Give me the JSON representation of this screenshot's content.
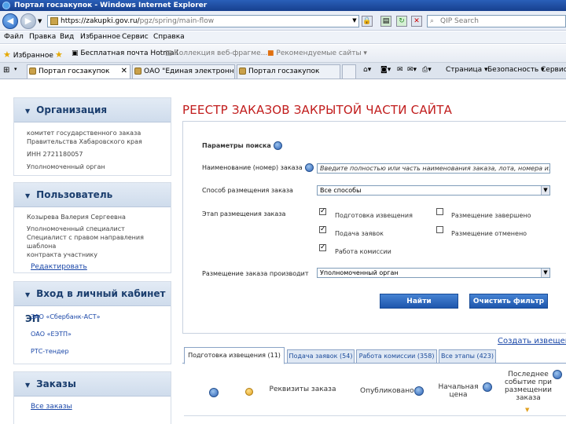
{
  "browser": {
    "title": "Портал госзакупок - Windows Internet Explorer",
    "url_main": "https://zakupki.gov.ru/",
    "url_rest": "pgz/spring/main-flow",
    "search_placeholder": "QIP Search",
    "menu": [
      "Файл",
      "Правка",
      "Вид",
      "Избранное",
      "Сервис",
      "Справка"
    ],
    "favorites_label": "Избранное",
    "fav_links": [
      "Бесплатная почта Hotmail",
      "Коллекция веб-фрагме...",
      "Рекомендуемые сайты"
    ],
    "tabs": [
      "Портал госзакупок",
      "ОАО \"Единая электронная...",
      "Портал госзакупок"
    ],
    "commands": [
      "Страница",
      "Безопасность",
      "Сервис"
    ]
  },
  "sidebar": {
    "org": {
      "title": "Организация",
      "lines": [
        "комитет государственного заказа",
        "Правительства Хабаровского края",
        "ИНН 2721180057",
        "Уполномоченный орган"
      ]
    },
    "user": {
      "title": "Пользователь",
      "lines": [
        "Козырева Валерия Сергеевна",
        "Уполномоченный специалист",
        "Специалист с правом направления шаблона",
        "контракта участнику"
      ],
      "edit_link": "Редактировать"
    },
    "cabinet": {
      "title": "Вход в личный кабинет ЭП",
      "links": [
        "ЗАО «Сбербанк-АСТ»",
        "ОАО «ЕЭТП»",
        "РТС-тендер"
      ]
    },
    "orders": {
      "title": "Заказы",
      "link": "Все заказы"
    }
  },
  "main": {
    "title": "РЕЕСТР ЗАКАЗОВ ЗАКРЫТОЙ ЧАСТИ САЙТА",
    "params_label": "Параметры поиска",
    "name_label": "Наименование (номер) заказа",
    "name_placeholder": "Введите полностью или часть наименования заказа, лота, номера извещения",
    "method_label": "Способ размещения заказа",
    "method_value": "Все способы",
    "stage_label": "Этап размещения заказа",
    "stages": [
      {
        "label": "Подготовка извещения",
        "checked": true
      },
      {
        "label": "Подача заявок",
        "checked": true
      },
      {
        "label": "Работа комиссии",
        "checked": true
      },
      {
        "label": "Размещение завершено",
        "checked": false
      },
      {
        "label": "Размещение отменено",
        "checked": false
      }
    ],
    "producer_label": "Размещение заказа производит",
    "producer_value": "Уполномоченный орган",
    "find_btn": "Найти",
    "clear_btn": "Очистить фильтр",
    "create_link": "Создать извещение",
    "result_tabs": [
      "Подготовка извещения (11)",
      "Подача заявок (54)",
      "Работа комиссии (358)",
      "Все этапы (423)"
    ],
    "columns": {
      "details": "Реквизиты заказа",
      "published": "Опубликовано",
      "price": "Начальная цена",
      "last_event": "Последнее событие при размещении заказа"
    }
  }
}
